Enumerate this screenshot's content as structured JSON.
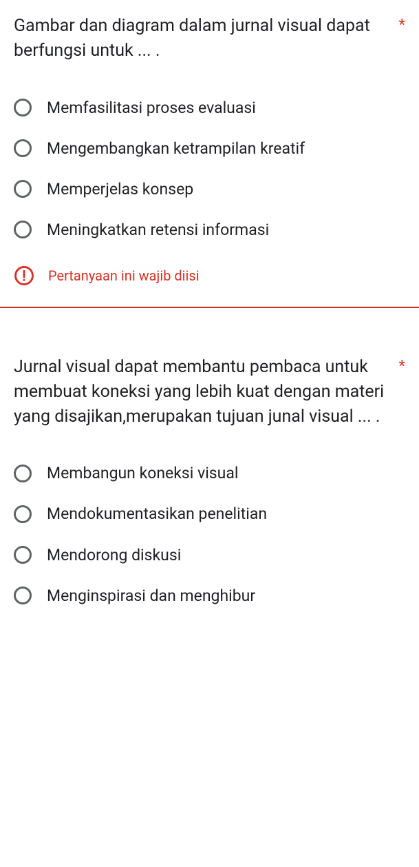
{
  "required_marker": "*",
  "error": {
    "text": "Pertanyaan ini wajib diisi"
  },
  "questions": [
    {
      "text": "Gambar dan diagram dalam jurnal visual dapat berfungsi untuk ... .",
      "options": [
        "Memfasilitasi proses evaluasi",
        "Mengembangkan ketrampilan kreatif",
        "Memperjelas konsep",
        "Meningkatkan retensi informasi"
      ],
      "show_error": true
    },
    {
      "text": "Jurnal visual dapat membantu pembaca untuk membuat koneksi yang lebih kuat dengan materi yang disajikan,merupakan tujuan junal visual ... .",
      "options": [
        "Membangun koneksi visual",
        "Mendokumentasikan penelitian",
        "Mendorong diskusi",
        "Menginspirasi dan menghibur"
      ],
      "show_error": false
    }
  ]
}
